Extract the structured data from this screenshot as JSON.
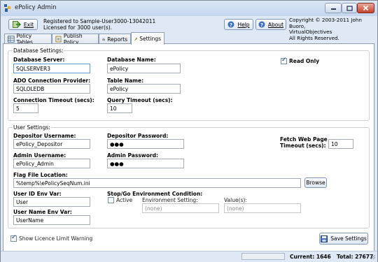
{
  "window": {
    "title": "ePolicy Admin",
    "minimize_icon": "minimize-icon",
    "maximize_icon": "maximize-icon",
    "close_icon": "close-icon"
  },
  "toolbar": {
    "exit_label": "Exit",
    "registration_line1": "Registered to Sample-User3000-13042011",
    "registration_line2": "Licensed for 3000 user(s).",
    "help_label": "Help",
    "about_label": "About",
    "copyright_line1": "Copyright © 2003-2011 John Buoro,",
    "copyright_line2": "VirtualObjectives",
    "copyright_line3": "All Rights Reserved."
  },
  "tabs": [
    {
      "label": "Policy Tables",
      "icon": "table-icon"
    },
    {
      "label": "Publish Policy",
      "icon": "publish-icon"
    },
    {
      "label": "Reports",
      "icon": "chart-icon"
    },
    {
      "label": "Settings",
      "icon": "wrench-icon"
    }
  ],
  "database": {
    "group_title": "Database Settings:",
    "server_label": "Database Server:",
    "server_value": "SQLSERVER3",
    "name_label": "Database Name:",
    "name_value": "ePolicy",
    "read_only_label": "Read Only",
    "provider_label": "ADO Connection Provider:",
    "provider_value": "SQLOLEDB",
    "table_label": "Table Name:",
    "table_value": "ePolicy",
    "conn_timeout_label": "Connection Timeout (secs):",
    "conn_timeout_value": "5",
    "query_timeout_label": "Query Timeout (secs):",
    "query_timeout_value": "10"
  },
  "user": {
    "group_title": "User Settings:",
    "depositor_user_label": "Depositor Username:",
    "depositor_user_value": "ePolicy_Depositor",
    "depositor_pass_label": "Depositor Password:",
    "depositor_pass_value": "●●●",
    "fetch_label_line1": "Fetch Web Page",
    "fetch_label_line2": "Timeout (secs):",
    "fetch_value": "10",
    "admin_user_label": "Admin Username:",
    "admin_user_value": "ePolicy_Admin",
    "admin_pass_label": "Admin Password:",
    "admin_pass_value": "●●●",
    "flag_label": "Flag File Location:",
    "flag_value": "%temp%\\ePolicySeqNum.ini",
    "browse_label": "Browse",
    "userid_env_label": "User ID Env Var:",
    "userid_env_value": "User",
    "stopgo_label": "Stop/Go Environment Condition:",
    "active_label": "Active",
    "env_setting_label": "Environment Setting:",
    "env_setting_placeholder": "(none)",
    "values_label": "Value(s):",
    "values_placeholder": "(none)",
    "username_env_label": "User Name Env Var:",
    "username_env_value": "UserName"
  },
  "footer": {
    "show_licence_label": "Show Licence Limit Warning",
    "save_label": "Save Settings"
  },
  "status": {
    "current_label": "Current: 1646",
    "total_label": "Total: 27677"
  }
}
